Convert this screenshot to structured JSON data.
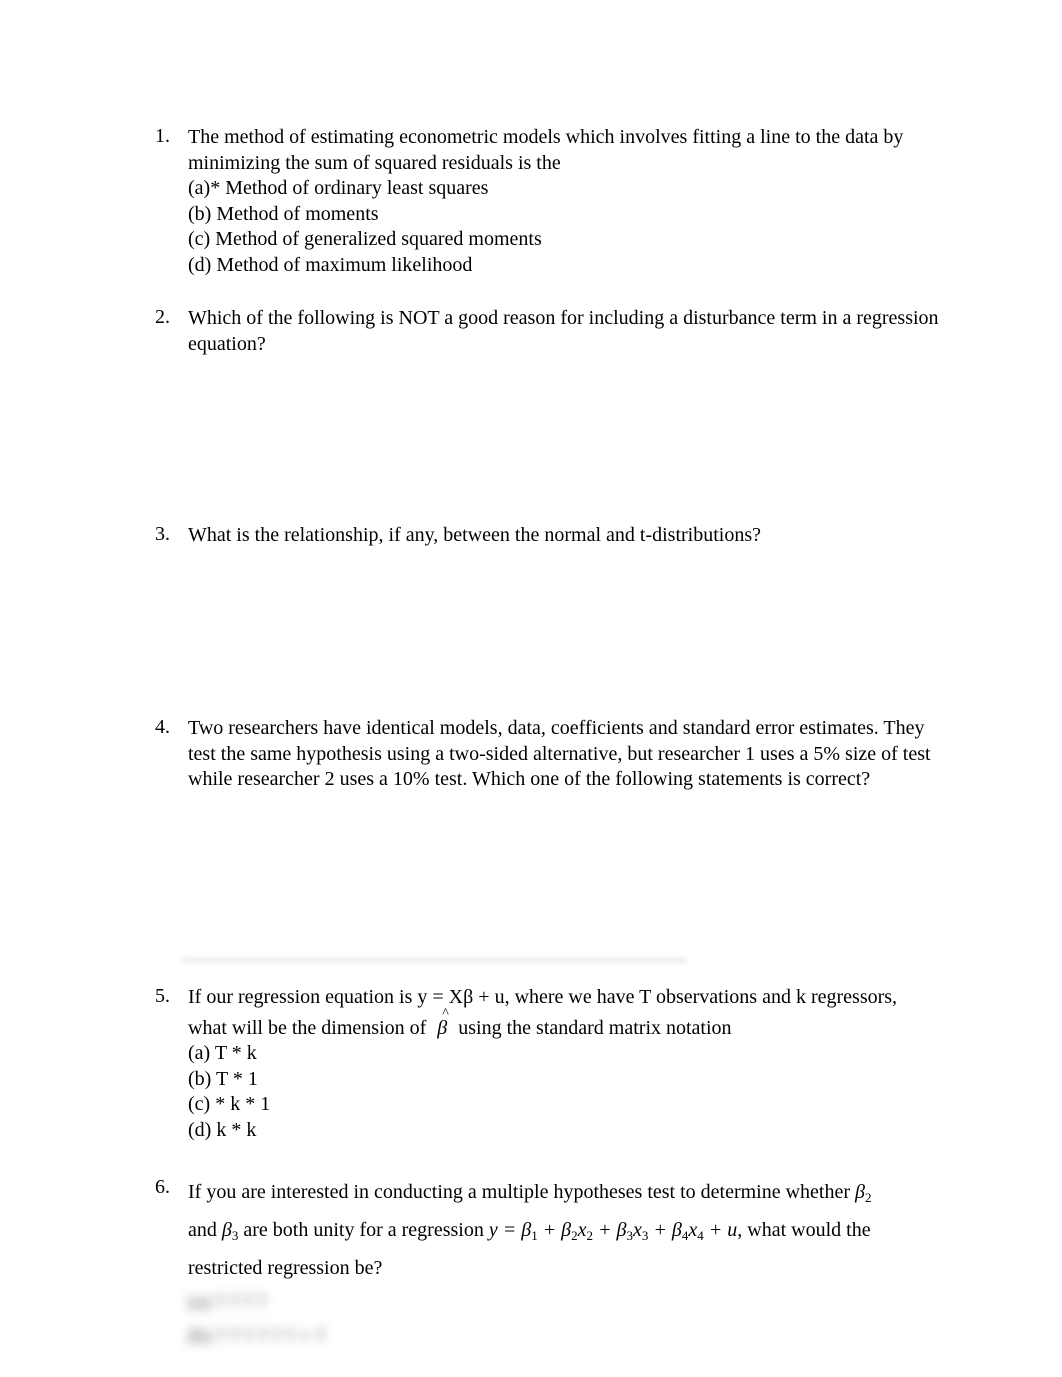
{
  "questions": [
    {
      "number": "1.",
      "text": "The method of estimating econometric models which involves fitting a line to the data by minimizing the sum of squared residuals is the",
      "options": [
        "(a)* Method of ordinary least squares",
        "(b) Method of moments",
        "(c) Method of generalized squared moments",
        "(d) Method of maximum likelihood"
      ]
    },
    {
      "number": "2.",
      "text": "Which of the following is NOT a good reason for including a disturbance term in a regression equation?"
    },
    {
      "number": "3.",
      "text": "What is the relationship, if any, between the normal and t-distributions?"
    },
    {
      "number": "4.",
      "text": "Two researchers have identical models, data, coefficients and standard error estimates. They test the same hypothesis using a two-sided alternative, but researcher 1 uses a 5% size of test while researcher 2 uses a 10% test. Which one of the following statements is correct?"
    },
    {
      "number": "5.",
      "text_line1": "If our regression equation is y = Xβ + u, where we have T observations and k regressors,",
      "text_line2_pre": "what will be the dimension of",
      "beta_symbol": "β",
      "text_line2_post": "using the standard matrix notation",
      "options": [
        "(a) T * k",
        "(b) T * 1",
        "(c) * k * 1",
        "(d) k * k"
      ]
    },
    {
      "number": "6.",
      "text_pre": "If you are interested in conducting a multiple hypotheses test to determine whether",
      "beta2": "β",
      "beta2_sub": "2",
      "and": "and",
      "beta3": "β",
      "beta3_sub": "3",
      "text_mid": "are both unity for a regression",
      "equation": {
        "y": "y = ",
        "t1": "β",
        "t1s": "1",
        "t2": " + β",
        "t2s": "2",
        "x2": "x",
        "x2s": "2",
        "t3": " + β",
        "t3s": "3",
        "x3": "x",
        "x3s": "3",
        "t4": " + β",
        "t4s": "4",
        "x4": "x",
        "x4s": "4",
        "u": " + u"
      },
      "text_post": ", what would the",
      "text_line3": "restricted regression be?",
      "blurred_line1": "(a) ?  ?  ?  ?",
      "blurred_line2": "(b) ?  ?  ?  ?  ?  ?  +  ?"
    }
  ]
}
